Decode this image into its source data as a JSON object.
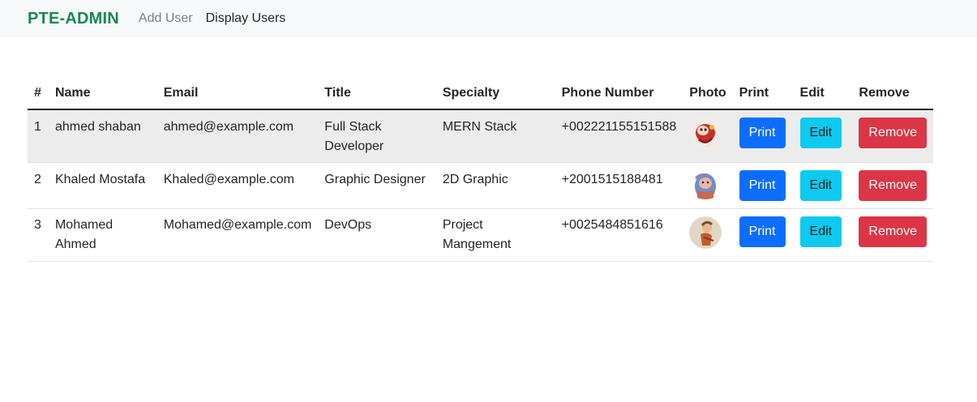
{
  "navbar": {
    "brand": "PTE-ADMIN",
    "links": [
      "Add User",
      "Display Users"
    ]
  },
  "table": {
    "headers": [
      "#",
      "Name",
      "Email",
      "Title",
      "Specialty",
      "Phone Number",
      "Photo",
      "Print",
      "Edit",
      "Remove"
    ],
    "rows": [
      {
        "num": "1",
        "name": "ahmed shaban",
        "email": "ahmed@example.com",
        "title": "Full Stack Developer",
        "specialty": "MERN Stack",
        "phone": "+002221155151588",
        "photo": "avatar-illustration",
        "print": "Print",
        "edit": "Edit",
        "remove": "Remove"
      },
      {
        "num": "2",
        "name": "Khaled Mostafa",
        "email": "Khaled@example.com",
        "title": "Graphic Designer",
        "specialty": "2D Graphic",
        "phone": "+2001515188481",
        "photo": "avatar-illustration",
        "print": "Print",
        "edit": "Edit",
        "remove": "Remove"
      },
      {
        "num": "3",
        "name": "Mohamed Ahmed",
        "email": "Mohamed@example.com",
        "title": "DevOps",
        "specialty": "Project Mangement",
        "phone": "+0025484851616",
        "photo": "avatar-illustration",
        "print": "Print",
        "edit": "Edit",
        "remove": "Remove"
      }
    ]
  },
  "colors": {
    "brand": "#198754",
    "print": "#0d6efd",
    "edit": "#0dcaf0",
    "remove": "#dc3545",
    "navbar_bg": "#f8f9fa",
    "stripe": "#ececec"
  }
}
